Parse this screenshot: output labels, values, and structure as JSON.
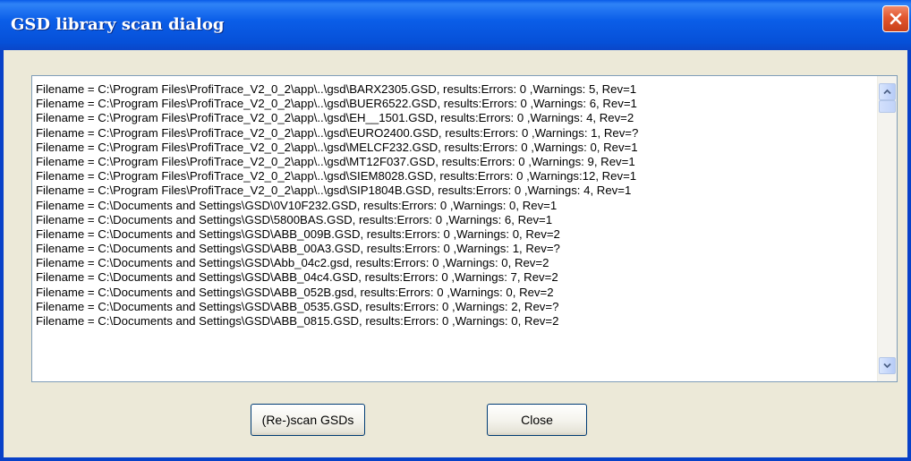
{
  "window": {
    "title": "GSD library scan dialog"
  },
  "listbox": {
    "lines": [
      "Filename = C:\\Program Files\\ProfiTrace_V2_0_2\\app\\..\\gsd\\BARX2305.GSD, results:Errors: 0 ,Warnings: 5, Rev=1",
      "Filename = C:\\Program Files\\ProfiTrace_V2_0_2\\app\\..\\gsd\\BUER6522.GSD, results:Errors: 0 ,Warnings: 6, Rev=1",
      "Filename = C:\\Program Files\\ProfiTrace_V2_0_2\\app\\..\\gsd\\EH__1501.GSD, results:Errors: 0 ,Warnings: 4, Rev=2",
      "Filename = C:\\Program Files\\ProfiTrace_V2_0_2\\app\\..\\gsd\\EURO2400.GSD, results:Errors: 0 ,Warnings: 1, Rev=?",
      "Filename = C:\\Program Files\\ProfiTrace_V2_0_2\\app\\..\\gsd\\MELCF232.GSD, results:Errors: 0 ,Warnings: 0, Rev=1",
      "Filename = C:\\Program Files\\ProfiTrace_V2_0_2\\app\\..\\gsd\\MT12F037.GSD, results:Errors: 0 ,Warnings: 9, Rev=1",
      "Filename = C:\\Program Files\\ProfiTrace_V2_0_2\\app\\..\\gsd\\SIEM8028.GSD, results:Errors: 0 ,Warnings:12, Rev=1",
      "Filename = C:\\Program Files\\ProfiTrace_V2_0_2\\app\\..\\gsd\\SIP1804B.GSD, results:Errors: 0 ,Warnings: 4, Rev=1",
      "Filename = C:\\Documents and Settings\\GSD\\0V10F232.GSD, results:Errors: 0 ,Warnings: 0, Rev=1",
      "Filename = C:\\Documents and Settings\\GSD\\5800BAS.GSD, results:Errors: 0 ,Warnings: 6, Rev=1",
      "Filename = C:\\Documents and Settings\\GSD\\ABB_009B.GSD, results:Errors: 0 ,Warnings: 0, Rev=2",
      "Filename = C:\\Documents and Settings\\GSD\\ABB_00A3.GSD, results:Errors: 0 ,Warnings: 1, Rev=?",
      "Filename = C:\\Documents and Settings\\GSD\\Abb_04c2.gsd, results:Errors: 0 ,Warnings: 0, Rev=2",
      "Filename = C:\\Documents and Settings\\GSD\\ABB_04c4.GSD, results:Errors: 0 ,Warnings: 7, Rev=2",
      "Filename = C:\\Documents and Settings\\GSD\\ABB_052B.gsd, results:Errors: 0 ,Warnings: 0, Rev=2",
      "Filename = C:\\Documents and Settings\\GSD\\ABB_0535.GSD, results:Errors: 0 ,Warnings: 2, Rev=?",
      "Filename = C:\\Documents and Settings\\GSD\\ABB_0815.GSD, results:Errors: 0 ,Warnings: 0, Rev=2"
    ]
  },
  "buttons": {
    "rescan_label": "(Re-)scan GSDs",
    "close_label": "Close"
  },
  "icons": {
    "close": "close-icon",
    "scroll_up": "chevron-up-icon",
    "scroll_down": "chevron-down-icon"
  },
  "colors": {
    "titlebar": "#0A5CE8",
    "window_bg": "#ECE9D8",
    "close_button": "#E2562E",
    "scrollbar_arrow": "#4D6185"
  }
}
